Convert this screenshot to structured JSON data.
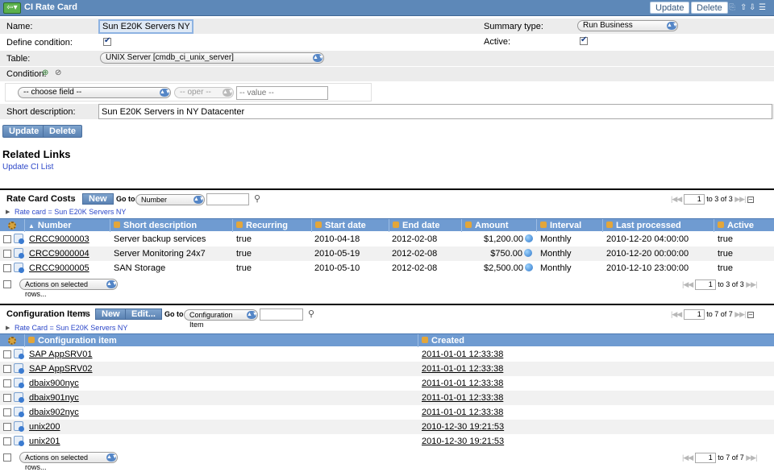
{
  "header": {
    "title": "CI Rate Card",
    "update_label": "Update",
    "delete_label": "Delete"
  },
  "form": {
    "name_label": "Name:",
    "name_value": "Sun E20K Servers NY",
    "define_condition_label": "Define condition:",
    "table_label": "Table:",
    "table_value": "UNIX Server [cmdb_ci_unix_server]",
    "condition_label": "Condition:",
    "choose_field": "-- choose field --",
    "oper": "-- oper --",
    "value_placeholder": "-- value --",
    "short_desc_label": "Short description:",
    "short_desc_value": "Sun E20K Servers in NY Datacenter",
    "summary_type_label": "Summary type:",
    "summary_type_value": "Run Business",
    "active_label": "Active:",
    "update_label": "Update",
    "delete_label": "Delete"
  },
  "related": {
    "title": "Related Links",
    "link": "Update CI List"
  },
  "rate_costs": {
    "title": "Rate Card Costs",
    "new_label": "New",
    "goto_label": "Go to",
    "goto_value": "Number",
    "breadcrumb": "Rate card = Sun E20K Servers NY",
    "pager_value": "1",
    "pager_text": "to 3 of 3",
    "columns": [
      "Number",
      "Short description",
      "Recurring",
      "Start date",
      "End date",
      "Amount",
      "Interval",
      "Last processed",
      "Active"
    ],
    "rows": [
      {
        "number": "CRCC9000003",
        "desc": "Server backup services",
        "recurring": "true",
        "start": "2010-04-18",
        "end": "2012-02-08",
        "amount": "$1,200.00",
        "interval": "Monthly",
        "last": "2010-12-20 04:00:00",
        "active": "true"
      },
      {
        "number": "CRCC9000004",
        "desc": "Server Monitoring 24x7",
        "recurring": "true",
        "start": "2010-05-19",
        "end": "2012-02-08",
        "amount": "$750.00",
        "interval": "Monthly",
        "last": "2010-12-20 00:00:00",
        "active": "true"
      },
      {
        "number": "CRCC9000005",
        "desc": "SAN Storage",
        "recurring": "true",
        "start": "2010-05-10",
        "end": "2012-02-08",
        "amount": "$2,500.00",
        "interval": "Monthly",
        "last": "2010-12-10 23:00:00",
        "active": "true"
      }
    ],
    "actions_label": "Actions on selected rows...",
    "footer_pager_value": "1",
    "footer_pager_text": "to 3 of 3"
  },
  "config_items": {
    "title": "Configuration Items",
    "new_label": "New",
    "edit_label": "Edit...",
    "goto_label": "Go to",
    "goto_value": "Configuration Item",
    "breadcrumb": "Rate Card = Sun E20K Servers NY",
    "pager_value": "1",
    "pager_text": "to 7 of 7",
    "columns": [
      "Configuration item",
      "Created"
    ],
    "rows": [
      {
        "item": "SAP AppSRV01",
        "created": "2011-01-01 12:33:38"
      },
      {
        "item": "SAP AppSRV02",
        "created": "2011-01-01 12:33:38"
      },
      {
        "item": "dbaix900nyc",
        "created": "2011-01-01 12:33:38"
      },
      {
        "item": "dbaix901nyc",
        "created": "2011-01-01 12:33:38"
      },
      {
        "item": "dbaix902nyc",
        "created": "2011-01-01 12:33:38"
      },
      {
        "item": "unix200",
        "created": "2010-12-30 19:21:53"
      },
      {
        "item": "unix201",
        "created": "2010-12-30 19:21:53"
      }
    ],
    "actions_label": "Actions on selected rows...",
    "footer_pager_value": "1",
    "footer_pager_text": "to 7 of 7"
  }
}
